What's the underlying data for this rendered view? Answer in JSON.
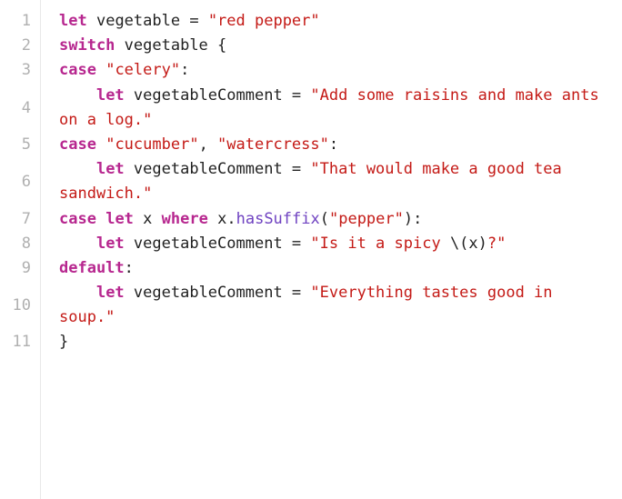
{
  "code": {
    "lines": [
      {
        "n": "1",
        "tokens": [
          {
            "t": "let",
            "c": "kw"
          },
          {
            "t": " ",
            "c": "id"
          },
          {
            "t": "vegetable",
            "c": "id"
          },
          {
            "t": " = ",
            "c": "op"
          },
          {
            "t": "\"red pepper\"",
            "c": "str"
          }
        ]
      },
      {
        "n": "2",
        "tokens": [
          {
            "t": "switch",
            "c": "kw"
          },
          {
            "t": " ",
            "c": "id"
          },
          {
            "t": "vegetable",
            "c": "id"
          },
          {
            "t": " {",
            "c": "op"
          }
        ]
      },
      {
        "n": "3",
        "tokens": [
          {
            "t": "case",
            "c": "kw"
          },
          {
            "t": " ",
            "c": "id"
          },
          {
            "t": "\"celery\"",
            "c": "str"
          },
          {
            "t": ":",
            "c": "op"
          }
        ]
      },
      {
        "n": "4",
        "tokens": [
          {
            "t": "    ",
            "c": "id"
          },
          {
            "t": "let",
            "c": "kw"
          },
          {
            "t": " ",
            "c": "id"
          },
          {
            "t": "vegetableComment",
            "c": "id"
          },
          {
            "t": " = ",
            "c": "op"
          },
          {
            "t": "\"Add some raisins and make ants on a log.\"",
            "c": "str"
          }
        ]
      },
      {
        "n": "5",
        "tokens": [
          {
            "t": "case",
            "c": "kw"
          },
          {
            "t": " ",
            "c": "id"
          },
          {
            "t": "\"cucumber\"",
            "c": "str"
          },
          {
            "t": ", ",
            "c": "op"
          },
          {
            "t": "\"watercress\"",
            "c": "str"
          },
          {
            "t": ":",
            "c": "op"
          }
        ]
      },
      {
        "n": "6",
        "tokens": [
          {
            "t": "    ",
            "c": "id"
          },
          {
            "t": "let",
            "c": "kw"
          },
          {
            "t": " ",
            "c": "id"
          },
          {
            "t": "vegetableComment",
            "c": "id"
          },
          {
            "t": " = ",
            "c": "op"
          },
          {
            "t": "\"That would make a good tea sandwich.\"",
            "c": "str"
          }
        ]
      },
      {
        "n": "7",
        "tokens": [
          {
            "t": "case",
            "c": "kw"
          },
          {
            "t": " ",
            "c": "id"
          },
          {
            "t": "let",
            "c": "kw"
          },
          {
            "t": " ",
            "c": "id"
          },
          {
            "t": "x",
            "c": "id"
          },
          {
            "t": " ",
            "c": "id"
          },
          {
            "t": "where",
            "c": "kw"
          },
          {
            "t": " ",
            "c": "id"
          },
          {
            "t": "x",
            "c": "id"
          },
          {
            "t": ".",
            "c": "op"
          },
          {
            "t": "hasSuffix",
            "c": "fn"
          },
          {
            "t": "(",
            "c": "paren"
          },
          {
            "t": "\"pepper\"",
            "c": "str"
          },
          {
            "t": ")",
            "c": "paren"
          },
          {
            "t": ":",
            "c": "op"
          }
        ]
      },
      {
        "n": "8",
        "tokens": [
          {
            "t": "    ",
            "c": "id"
          },
          {
            "t": "let",
            "c": "kw"
          },
          {
            "t": " ",
            "c": "id"
          },
          {
            "t": "vegetableComment",
            "c": "id"
          },
          {
            "t": " = ",
            "c": "op"
          },
          {
            "t": "\"Is it a spicy ",
            "c": "str"
          },
          {
            "t": "\\(",
            "c": "op"
          },
          {
            "t": "x",
            "c": "id"
          },
          {
            "t": ")",
            "c": "op"
          },
          {
            "t": "?\"",
            "c": "str"
          }
        ]
      },
      {
        "n": "9",
        "tokens": [
          {
            "t": "default",
            "c": "kw"
          },
          {
            "t": ":",
            "c": "op"
          }
        ]
      },
      {
        "n": "10",
        "tokens": [
          {
            "t": "    ",
            "c": "id"
          },
          {
            "t": "let",
            "c": "kw"
          },
          {
            "t": " ",
            "c": "id"
          },
          {
            "t": "vegetableComment",
            "c": "id"
          },
          {
            "t": " = ",
            "c": "op"
          },
          {
            "t": "\"Everything tastes good in soup.\"",
            "c": "str"
          }
        ]
      },
      {
        "n": "11",
        "tokens": [
          {
            "t": "}",
            "c": "op"
          }
        ]
      }
    ]
  }
}
